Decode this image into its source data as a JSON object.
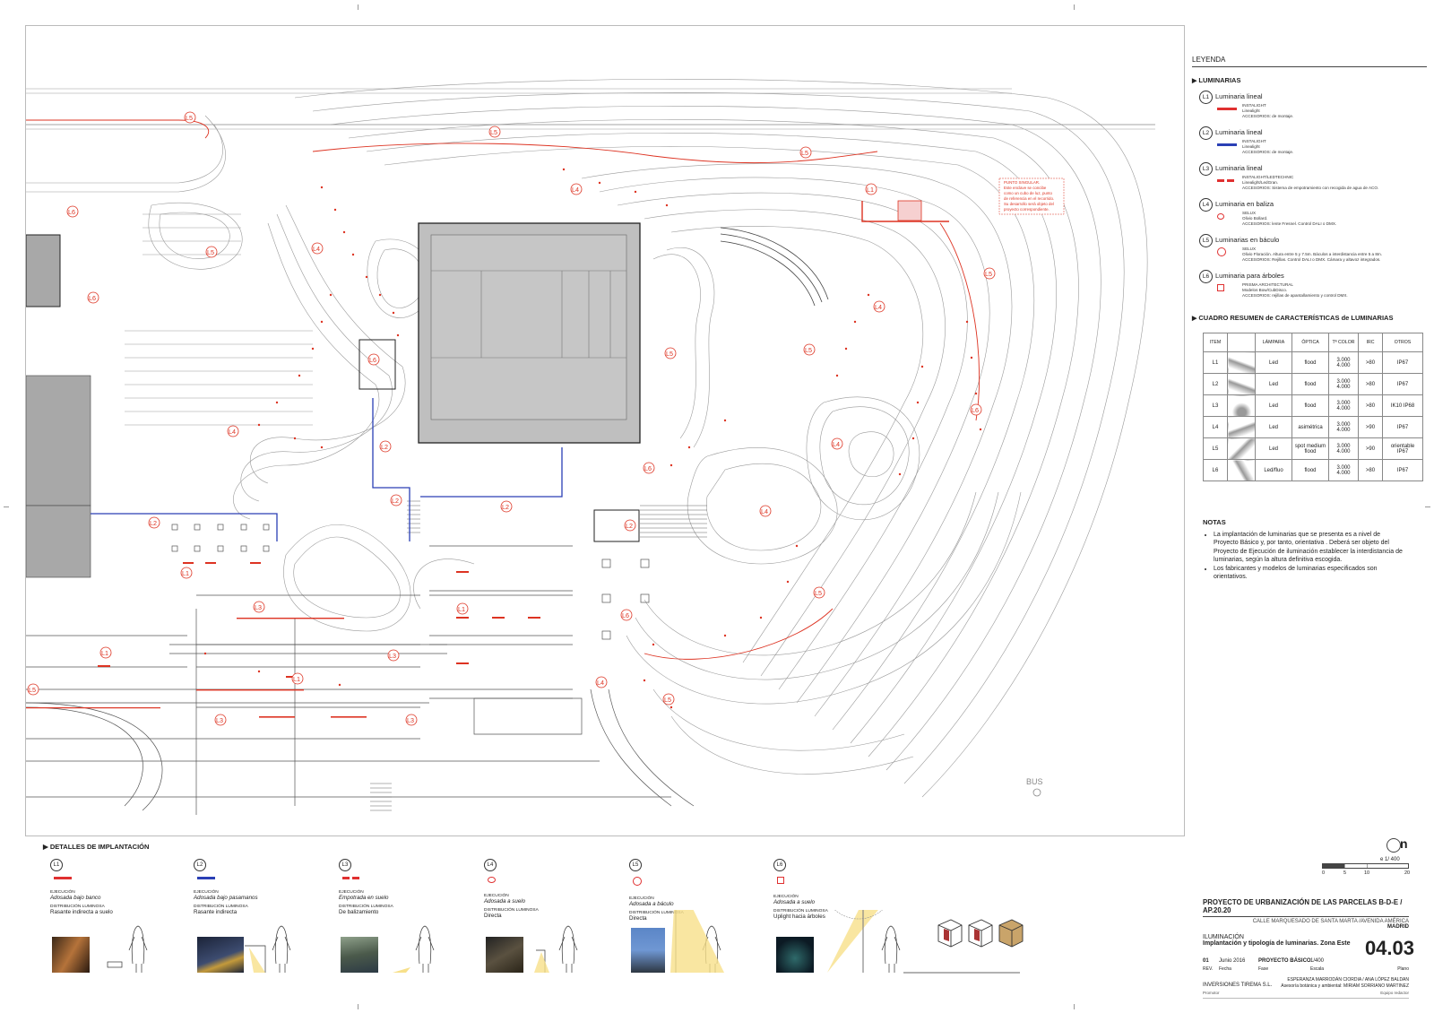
{
  "legend": {
    "title": "LEYENDA",
    "section_luminarias": "LUMINARIAS",
    "items": [
      {
        "tag": "L1",
        "name": "Luminaria lineal",
        "color": "#e03030",
        "lines": [
          "INSTALIGHT",
          "Linealight",
          "ACCESORIOS: de montaje."
        ]
      },
      {
        "tag": "L2",
        "name": "Luminaria lineal",
        "color": "#2a3fb5",
        "lines": [
          "INSTALIGHT",
          "Linealight",
          "ACCESORIOS: de montaje."
        ]
      },
      {
        "tag": "L3",
        "name": "Luminaria lineal",
        "color": "#e03030",
        "lines": [
          "INSTALIGHT/LEDTECHNIC",
          "Linealight/LedGran.",
          "ACCESORIOS: Sistema de empotramiento con recogida de agua de ACO."
        ]
      },
      {
        "tag": "L4",
        "name": "Luminaria en baliza",
        "color": "#e03030",
        "lines": [
          "SELUX",
          "Olivio Bollard.",
          "ACCESORIOS: lente Fresnel. Control DALI o DMX."
        ]
      },
      {
        "tag": "L5",
        "name": "Luminarias en báculo",
        "color": "#e03030",
        "lines": [
          "SELUX",
          "Olivio Floración. Altura entre 5 y 7.5m. Báculos a interdistancia entre 5 a 8m.",
          "ACCESORIOS: Rejillas. Control DALI o DMX. Cámara y altavoz integrados."
        ]
      },
      {
        "tag": "L6",
        "name": "Luminaria para árboles",
        "color": "#e03030",
        "lines": [
          "PRISMA ARCHITECTURAL",
          "Modelos Bow/CubDisco.",
          "ACCESORIOS: rejillas de apantallamiento y control DMX."
        ]
      }
    ],
    "section_cuadro": "CUADRO RESUMEN de CARACTERÍSTICAS de LUMINARIAS"
  },
  "summary": {
    "headers": [
      "ITEM",
      "",
      "LÁMPARA",
      "ÓPTICA",
      "Tª COLOR",
      "IRC",
      "OTROS"
    ],
    "rows": [
      [
        "L1",
        "",
        "Led",
        "flood",
        "3.000 4.000",
        ">80",
        "IP67"
      ],
      [
        "L2",
        "",
        "Led",
        "flood",
        "3.000 4.000",
        ">80",
        "IP67"
      ],
      [
        "L3",
        "",
        "Led",
        "flood",
        "3.000 4.000",
        ">80",
        "IK10 IP68"
      ],
      [
        "L4",
        "",
        "Led",
        "asimétrica",
        "3.000 4.000",
        ">90",
        "IP67"
      ],
      [
        "L5",
        "",
        "Led",
        "spot medium flood",
        "3.000 4.000",
        ">90",
        "orientable IP67"
      ],
      [
        "L6",
        "",
        "Led/fluo",
        "flood",
        "3.000 4.000",
        ">80",
        "IP67"
      ]
    ]
  },
  "notes": {
    "title": "NOTAS",
    "items": [
      "La implantación de luminarias que se presenta es a nivel de Proyecto Básico y, por tanto, orientativa . Deberá ser objeto del Proyecto de Ejecución de iluminación establecer la interdistancia de luminarias, según la altura definitiva escogida.",
      "Los fabricantes y modelos de luminarias especificados son orientativos."
    ]
  },
  "plan": {
    "punto_singular": [
      "PUNTO SINGULAR.",
      "Este enclave se concibe",
      "como un cubo de luz, punto",
      "de referencia en el recorrido.",
      "Su desarrollo será objeto del",
      "proyecto correspondiente."
    ],
    "bus": "BUS",
    "labels": [
      "L1",
      "L2",
      "L3",
      "L4",
      "L5",
      "L6"
    ]
  },
  "details": {
    "title": "DETALLES DE IMPLANTACIÓN",
    "k_ejec": "EJECUCIÓN",
    "k_dist": "DISTRIBUCIÓN LUMINOSA",
    "cols": [
      {
        "tag": "L1",
        "ejec": "Adosada bajo banco",
        "dist": "Rasante indirecta a suelo"
      },
      {
        "tag": "L2",
        "ejec": "Adosada bajo pasamanos",
        "dist": "Rasante indirecta"
      },
      {
        "tag": "L3",
        "ejec": "Empotrada en suelo",
        "dist": "De balizamiento"
      },
      {
        "tag": "L4",
        "ejec": "Adosada a suelo",
        "dist": "Directa"
      },
      {
        "tag": "L5",
        "ejec": "Adosada a báculo",
        "dist": "Directa"
      },
      {
        "tag": "L6",
        "ejec": "Adosada a suelo",
        "dist": "Uplight hacia árboles"
      }
    ]
  },
  "scale": {
    "north": "n",
    "label": "e 1/ 400",
    "ticks": [
      "0",
      "5",
      "10",
      "20"
    ]
  },
  "title_block": {
    "project": "PROYECTO DE URBANIZACIÓN DE LAS PARCELAS B-D-E / AP.20.20",
    "address": "CALLE MARQUESADO DE SANTA MARTA /AVENIDA AMÉRICA",
    "city": "MADRID",
    "topic": "ILUMINACIÓN",
    "subtitle": "Implantación y tipología de luminarias. Zona Este",
    "sheet": "04.03",
    "rev": "01",
    "rev_k": "REV.",
    "date": "Junio 2016",
    "date_k": "Fecha",
    "phase": "PROYECTO BÁSICO",
    "phase_k": "Fase",
    "scale": "1/400",
    "scale_k": "Escala",
    "plano_k": "Plano",
    "team": "ESPERANZA MARRODÁN CIORDIA / ANA LÓPEZ BALDAN",
    "team2": "Asesoría botánica y ambiental: MIRIAM SORRIANO MARTINEZ",
    "team_k": "Equipo redactor",
    "promoter": "INVERSIONES TIREMA S.L.",
    "promoter_k": "Promotor"
  },
  "colors": {
    "red": "#e03030",
    "blue": "#2a3fb5",
    "grey": "#a8a8a8"
  }
}
